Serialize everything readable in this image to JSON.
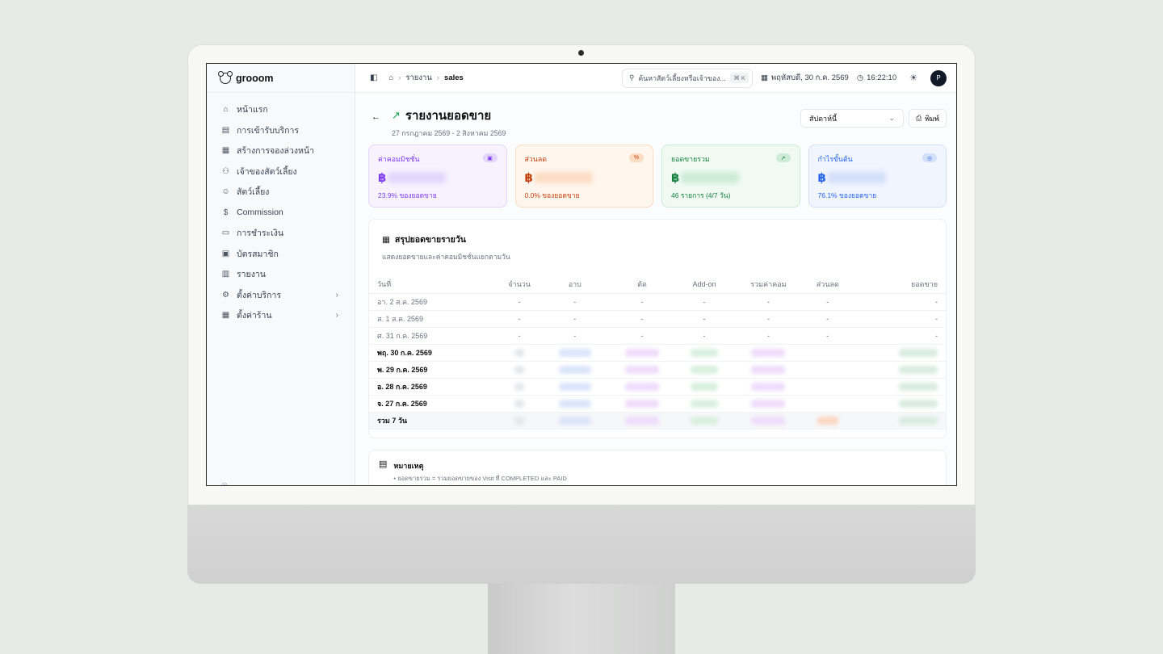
{
  "app": {
    "brand": "grooom"
  },
  "sidebar": {
    "items": [
      {
        "label": "หน้าแรก",
        "icon": "home-icon"
      },
      {
        "label": "การเข้ารับบริการ",
        "icon": "clipboard-icon"
      },
      {
        "label": "สร้างการจองล่วงหน้า",
        "icon": "calendar-plus-icon"
      },
      {
        "label": "เจ้าของสัตว์เลี้ยง",
        "icon": "users-icon"
      },
      {
        "label": "สัตว์เลี้ยง",
        "icon": "paw-icon"
      },
      {
        "label": "Commission",
        "icon": "dollar-icon"
      },
      {
        "label": "การชำระเงิน",
        "icon": "card-icon"
      },
      {
        "label": "บัตรสมาชิก",
        "icon": "id-card-icon"
      },
      {
        "label": "รายงาน",
        "icon": "report-icon"
      },
      {
        "label": "ตั้งค่าบริการ",
        "icon": "gear-icon"
      },
      {
        "label": "ตั้งค่าร้าน",
        "icon": "store-icon"
      }
    ]
  },
  "topbar": {
    "breadcrumb": [
      "รายงาน",
      "sales"
    ],
    "search_placeholder": "ค้นหาสัตว์เลี้ยงหรือเจ้าของ...",
    "search_shortcut": "⌘ K",
    "date": "พฤหัสบดี, 30 ก.ค. 2569",
    "time": "16:22:10",
    "avatar_initial": "P"
  },
  "page": {
    "title": "รายงานยอดขาย",
    "date_range": "27 กรกฎาคม 2569 - 2 สิงหาคม 2569",
    "period_select": "สัปดาห์นี้",
    "print_label": "พิมพ์"
  },
  "cards": [
    {
      "label": "ค่าคอมมิชชั่น",
      "currency": "฿",
      "sub": "23.9% ของยอดขาย",
      "fg": "#7c3aed",
      "bg": "#f7f2fe",
      "border": "#e4d6fb",
      "badge": "▣"
    },
    {
      "label": "ส่วนลด",
      "currency": "฿",
      "sub": "0.0% ของยอดขาย",
      "fg": "#c2410c",
      "bg": "#fff6ee",
      "border": "#fbdcc2",
      "badge": "%"
    },
    {
      "label": "ยอดขายรวม",
      "currency": "฿",
      "sub": "46 รายการ (4/7 วัน)",
      "fg": "#15803d",
      "bg": "#f0faf3",
      "border": "#cdebd6",
      "badge": "↗"
    },
    {
      "label": "กำไรขั้นต้น",
      "currency": "฿",
      "sub": "76.1% ของยอดขาย",
      "fg": "#2563eb",
      "bg": "#f0f5fe",
      "border": "#d3e0fa",
      "badge": "◎"
    }
  ],
  "summary": {
    "title": "สรุปยอดขายรายวัน",
    "subtitle": "แสดงยอดขายและค่าคอมมิชชั่นแยกตามวัน",
    "columns": [
      "วันที่",
      "จำนวน",
      "อาบ",
      "ตัด",
      "Add-on",
      "รวมค่าคอม",
      "ส่วนลด",
      "ยอดขาย"
    ],
    "rows": [
      {
        "date": "อา. 2 ส.ค. 2569",
        "empty": true
      },
      {
        "date": "ส. 1 ส.ค. 2569",
        "empty": true
      },
      {
        "date": "ศ. 31 ก.ค. 2569",
        "empty": true
      },
      {
        "date": "พฤ. 30 ก.ค. 2569",
        "empty": false
      },
      {
        "date": "พ. 29 ก.ค. 2569",
        "empty": false
      },
      {
        "date": "อ. 28 ก.ค. 2569",
        "empty": false
      },
      {
        "date": "จ. 27 ก.ค. 2569",
        "empty": false
      }
    ],
    "dash": "-",
    "total_label": "รวม 7 วัน"
  },
  "notes": {
    "title": "หมายเหตุ",
    "line1": "• ยอดขายรวม = รวมยอดขายของ Visit ที่ COMPLETED และ PAID"
  }
}
